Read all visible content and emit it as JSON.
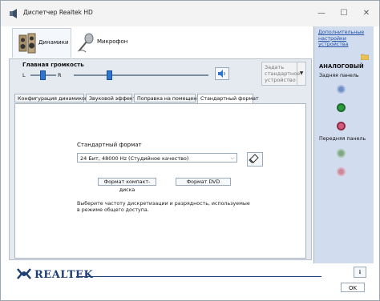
{
  "window": {
    "title": "Диспетчер Realtek HD",
    "controls": {
      "minimize": "—",
      "maximize": "☐",
      "close": "✕"
    }
  },
  "device_tabs": [
    {
      "label": "Динамики",
      "icon": "speakers-icon",
      "active": true
    },
    {
      "label": "Микрофон",
      "icon": "microphone-icon",
      "active": false
    }
  ],
  "volume": {
    "label": "Главная громкость",
    "left_label": "L",
    "right_label": "R",
    "balance": 0.5,
    "level": 0.5,
    "speaker_icon": "speaker-volume-icon"
  },
  "default_device": {
    "label": "Задать стандартное устройство",
    "arrow": "▼"
  },
  "subtabs": [
    {
      "label": "Конфигурация динамиков",
      "active": false
    },
    {
      "label": "Звуковой эффект",
      "active": false
    },
    {
      "label": "Поправка на помещение",
      "active": false
    },
    {
      "label": "Стандартный формат",
      "active": true
    }
  ],
  "format": {
    "label": "Стандартный формат",
    "selected": "24 Бит, 48000 Hz (Студийное качество)",
    "cd_button": "Формат компакт-диска",
    "dvd_button": "Формат DVD",
    "hint": "Выберите частоту дискретизации и разрядность, используемые в режиме общего доступа.",
    "reset_icon": "eraser-icon"
  },
  "right_panel": {
    "advanced_link": "Дополнительные настройки устройства",
    "analog_title": "АНАЛОГОВЫЙ",
    "rear_panel": "Задняя панель",
    "front_panel": "Передняя панель",
    "jack_colors": {
      "blue": "#6f8fc7",
      "green": "#2b9c3e",
      "pink": "#d45a7a",
      "front_green": "#7fa886",
      "front_pink": "#c98a9c"
    }
  },
  "brand": {
    "name": "REALTEK"
  },
  "footer": {
    "ok": "OK",
    "info_icon": "info-icon"
  }
}
